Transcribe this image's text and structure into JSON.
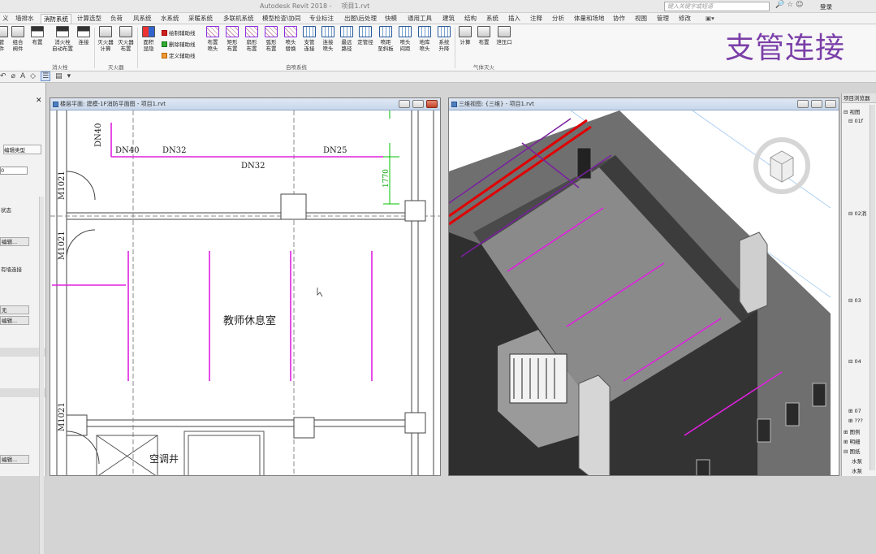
{
  "app": {
    "title": "Autodesk Revit 2018 -",
    "doc": "项目1.rvt",
    "search_placeholder": "键入关键字或短语",
    "login": "登录"
  },
  "tabs": [
    "义",
    "墙排水",
    "消防系统",
    "计算选型",
    "负荷",
    "风系统",
    "水系统",
    "采暖系统",
    "多联机系统",
    "模型检查\\协同",
    "专业标注",
    "出图\\后处理",
    "快模",
    "通用工具",
    "建筑",
    "结构",
    "系统",
    "插入",
    "注释",
    "分析",
    "体量和场地",
    "协作",
    "视图",
    "管理",
    "修改"
  ],
  "active_tab": "消防系统",
  "ribbon": {
    "buttons": [
      "管\n件",
      "组合\n阀件",
      "布置",
      "消火栓\n自动布置",
      "连接",
      "灭火器\n计算",
      "灭火器\n布置",
      "面积\n显隐",
      "布置\n喷头",
      "矩形\n布置",
      "扇形\n布置",
      "弧形\n布置",
      "喷头\n替换",
      "支管\n连接",
      "连接\n喷头",
      "最远\n路径",
      "定管径",
      "喷距\n至斜板",
      "喷头\n间距",
      "地库\n喷头",
      "系统\n升降",
      "计算",
      "布置",
      "泄压口"
    ],
    "small": [
      "绘制辅助线",
      "删除辅助线",
      "定义辅助线"
    ],
    "panels": [
      "消火栓",
      "灭火器",
      "自喷系统",
      "气体灭火"
    ]
  },
  "overlay_title": "支管连接",
  "properties": {
    "edit_type": "编辑类型",
    "value_0": "0",
    "state": "状态",
    "edit_btn": "编辑...",
    "wall_conn": "有墙连接",
    "none": "无",
    "edit_btn2": "编辑...",
    "edit_btn3": "编辑..."
  },
  "plan_view": {
    "title": "楼层平面: 建模-1F消防平面图 - 项目1.rvt",
    "labels": {
      "dn40v": "DN40",
      "dn40": "DN40",
      "dn32a": "DN32",
      "dn32b": "DN32",
      "dn25": "DN25",
      "dim": "1770",
      "m1": "M1021",
      "m2": "M1021",
      "m3": "M1021",
      "room": "教师休息室",
      "duct": "空调井"
    }
  },
  "view3d": {
    "title": "三维视图: {三维} - 项目1.rvt"
  },
  "browser": {
    "header": "项目浏览器",
    "items": [
      "视图",
      "01f",
      "02消",
      "03",
      "04",
      "07",
      "???",
      "图例",
      "明细",
      "图纸",
      "水泵",
      "水泵"
    ]
  },
  "colors": {
    "pipe": "#e020e0",
    "accent": "#7b3fa8",
    "red_pipe": "#e00000",
    "dim_green": "#00c000"
  }
}
